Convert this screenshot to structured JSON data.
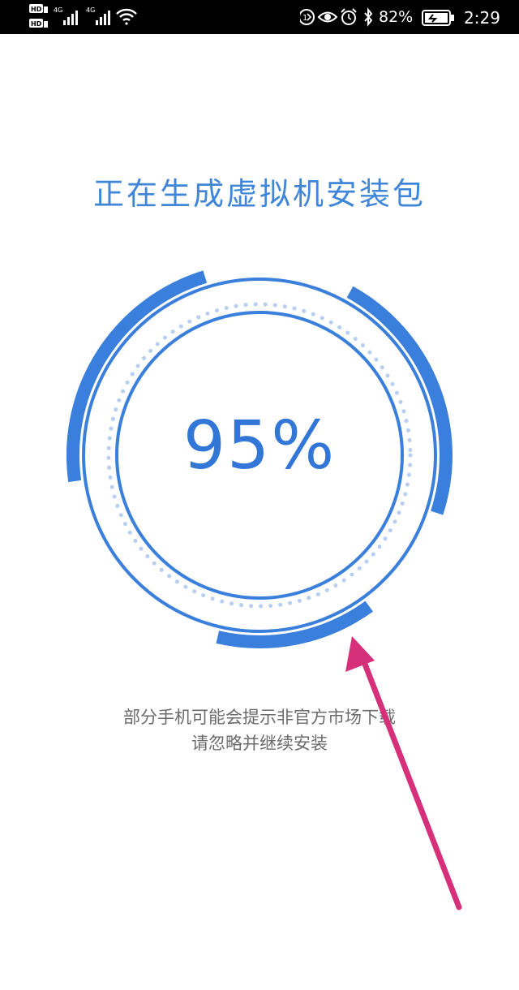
{
  "status_bar": {
    "sim1": "HD",
    "sim2": "HD",
    "network1": "4G",
    "network2": "4G",
    "battery_percent": "82%",
    "time": "2:29"
  },
  "main": {
    "title": "正在生成虚拟机安装包",
    "progress_label": "95%",
    "progress_value": 0.95,
    "hint_line1": "部分手机可能会提示非官方市场下载",
    "hint_line2": "请忽略并继续安装"
  },
  "colors": {
    "accent": "#3f86d9",
    "ring": "#3276d8",
    "dots": "#b9cff0",
    "annotation_arrow": "#d6307a"
  },
  "icons": [
    "wifi-icon",
    "signal-icon",
    "data-saver-icon",
    "eye-comfort-icon",
    "alarm-icon",
    "bluetooth-icon",
    "battery-icon"
  ]
}
